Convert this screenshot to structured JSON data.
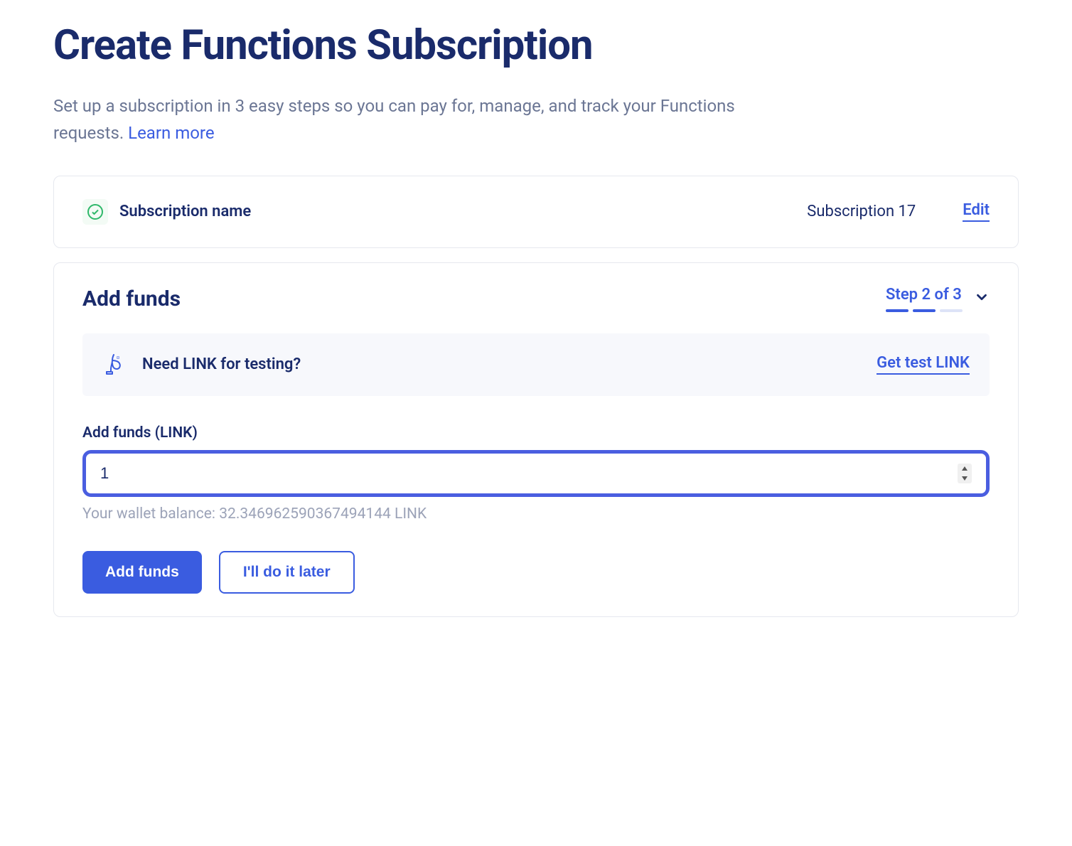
{
  "page": {
    "title": "Create Functions Subscription",
    "description": "Set up a subscription in 3 easy steps so you can pay for, manage, and track your Functions requests. ",
    "learn_more": "Learn more"
  },
  "step1": {
    "label": "Subscription name",
    "value": "Subscription  17",
    "edit_label": "Edit"
  },
  "step2": {
    "title": "Add funds",
    "step_text": "Step 2 of 3",
    "banner_text": "Need LINK for testing?",
    "banner_link": "Get test LINK",
    "input_label": "Add funds (LINK)",
    "input_value": "1",
    "wallet_balance": "Your wallet balance: 32.346962590367494144 LINK",
    "primary_button": "Add funds",
    "secondary_button": "I'll do it later"
  }
}
